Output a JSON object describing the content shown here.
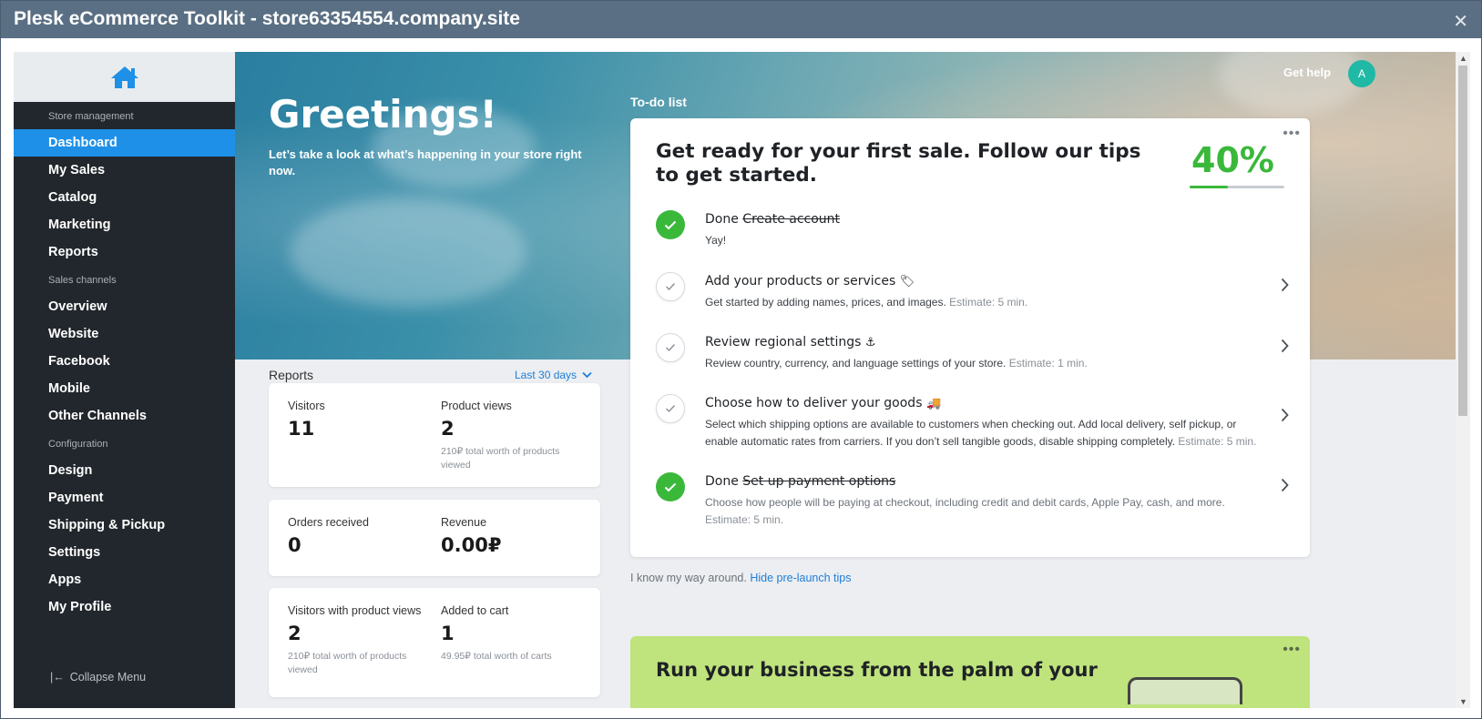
{
  "window": {
    "title": "Plesk eCommerce Toolkit - store63354554.company.site",
    "close_glyph": "✕"
  },
  "sidebar": {
    "home_icon": "home-icon",
    "sections": [
      {
        "label": "Store management",
        "items": [
          "Dashboard",
          "My Sales",
          "Catalog",
          "Marketing",
          "Reports"
        ]
      },
      {
        "label": "Sales channels",
        "items": [
          "Overview",
          "Website",
          "Facebook",
          "Mobile",
          "Other Channels"
        ]
      },
      {
        "label": "Configuration",
        "items": [
          "Design",
          "Payment",
          "Shipping & Pickup",
          "Settings",
          "Apps",
          "My Profile"
        ]
      }
    ],
    "active_item": "Dashboard",
    "collapse_label": "Collapse Menu",
    "collapse_icon": "collapse-icon"
  },
  "header": {
    "get_help": "Get help",
    "avatar_letter": "A"
  },
  "hero": {
    "title": "Greetings!",
    "subtitle": "Let’s take a look at what’s happening in your store right now."
  },
  "reports": {
    "title": "Reports",
    "period": "Last 30 days",
    "cards": [
      {
        "left": {
          "label": "Visitors",
          "value": "11",
          "note": ""
        },
        "right": {
          "label": "Product views",
          "value": "2",
          "note": "210₽ total worth of products viewed"
        }
      },
      {
        "left": {
          "label": "Orders received",
          "value": "0",
          "note": ""
        },
        "right": {
          "label": "Revenue",
          "value": "0.00₽",
          "note": ""
        }
      },
      {
        "left": {
          "label": "Visitors with product views",
          "value": "2",
          "note": "210₽ total worth of products viewed"
        },
        "right": {
          "label": "Added to cart",
          "value": "1",
          "note": "49.95₽ total worth of carts"
        }
      }
    ]
  },
  "todo": {
    "section_title": "To-do list",
    "heading": "Get ready for your first sale. Follow our tips to get started.",
    "percent": "40%",
    "progress": 0.4,
    "tasks": [
      {
        "done": true,
        "prefix": "Done",
        "title": "Create account",
        "emoji": "",
        "desc": "Yay!",
        "estimate": "",
        "chevron": false
      },
      {
        "done": false,
        "prefix": "",
        "title": "Add your products or services",
        "emoji": "🏷",
        "desc": "Get started by adding names, prices, and images.",
        "estimate": "Estimate: 5 min.",
        "chevron": true
      },
      {
        "done": false,
        "prefix": "",
        "title": "Review regional settings",
        "emoji": "⚓",
        "desc": "Review country, currency, and language settings of your store.",
        "estimate": "Estimate: 1 min.",
        "chevron": true
      },
      {
        "done": false,
        "prefix": "",
        "title": "Choose how to deliver your goods",
        "emoji": "🚚",
        "desc": "Select which shipping options are available to customers when checking out. Add local delivery, self pickup, or enable automatic rates from carriers. If you don’t sell tangible goods, disable shipping completely.",
        "estimate": "Estimate: 5 min.",
        "chevron": true
      },
      {
        "done": true,
        "prefix": "Done",
        "title": "Set up payment options",
        "emoji": "",
        "desc": "Choose how people will be paying at checkout, including credit and debit cards, Apple Pay, cash, and more.",
        "estimate": "Estimate: 5 min.",
        "chevron": true
      }
    ],
    "know_text": "I know my way around.",
    "hide_link": "Hide pre-launch tips"
  },
  "promo": {
    "title": "Run your business from the palm of your"
  },
  "colors": {
    "accent": "#1e90e8",
    "success": "#3ab83a",
    "sidebar_bg": "#22272d",
    "promo_bg": "#bfe37d"
  }
}
